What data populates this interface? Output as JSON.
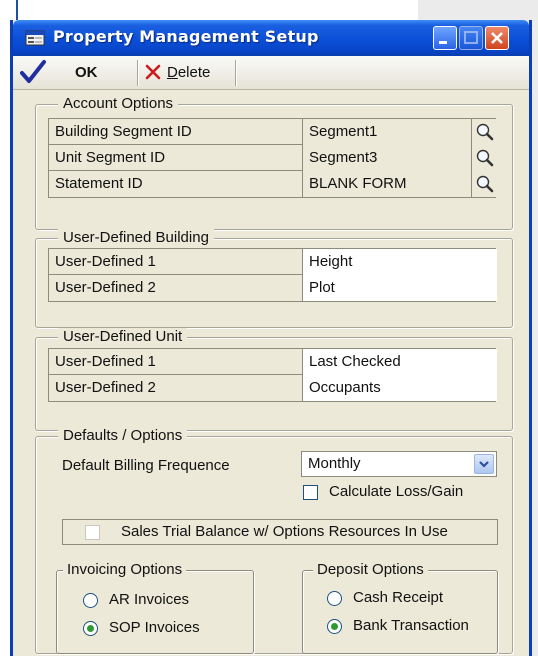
{
  "window": {
    "title": "Property Management Setup"
  },
  "toolbar": {
    "ok_label": "OK",
    "delete_label_prefix": "D",
    "delete_label_rest": "elete"
  },
  "account_options": {
    "legend": "Account Options",
    "rows": [
      {
        "label": "Building Segment ID",
        "value": "Segment1"
      },
      {
        "label": "Unit Segment ID",
        "value": "Segment3"
      },
      {
        "label": "Statement ID",
        "value": "BLANK FORM"
      }
    ]
  },
  "user_defined_building": {
    "legend": "User-Defined Building",
    "rows": [
      {
        "label": "User-Defined 1",
        "value": "Height"
      },
      {
        "label": "User-Defined 2",
        "value": "Plot"
      }
    ]
  },
  "user_defined_unit": {
    "legend": "User-Defined Unit",
    "rows": [
      {
        "label": "User-Defined 1",
        "value": "Last Checked"
      },
      {
        "label": "User-Defined 2",
        "value": "Occupants"
      }
    ]
  },
  "defaults": {
    "legend": "Defaults / Options",
    "billing_label": "Default Billing Frequence",
    "billing_value": "Monthly",
    "calc_loss_gain_label": "Calculate Loss/Gain",
    "calc_loss_gain_checked": false,
    "sales_trial_label": "Sales Trial Balance w/ Options Resources In Use",
    "sales_trial_checked": false
  },
  "invoicing_options": {
    "legend": "Invoicing Options",
    "options": [
      {
        "label": "AR Invoices",
        "selected": false
      },
      {
        "label": "SOP Invoices",
        "selected": true
      }
    ]
  },
  "deposit_options": {
    "legend": "Deposit Options",
    "options": [
      {
        "label": "Cash Receipt",
        "selected": false
      },
      {
        "label": "Bank Transaction",
        "selected": true
      }
    ]
  },
  "colors": {
    "titlebar": "#0b4fd8",
    "window_bg": "#ece9d8",
    "radio_selected": "#2f9a2f",
    "ok_check": "#1f2f9e",
    "delete_x": "#cc1a1a"
  },
  "icons": {
    "app": "setup-window-icon",
    "ok": "checkmark-icon",
    "delete": "x-icon",
    "lookup": "magnifier-lookup-icon",
    "dropdown": "chevron-down-icon"
  }
}
